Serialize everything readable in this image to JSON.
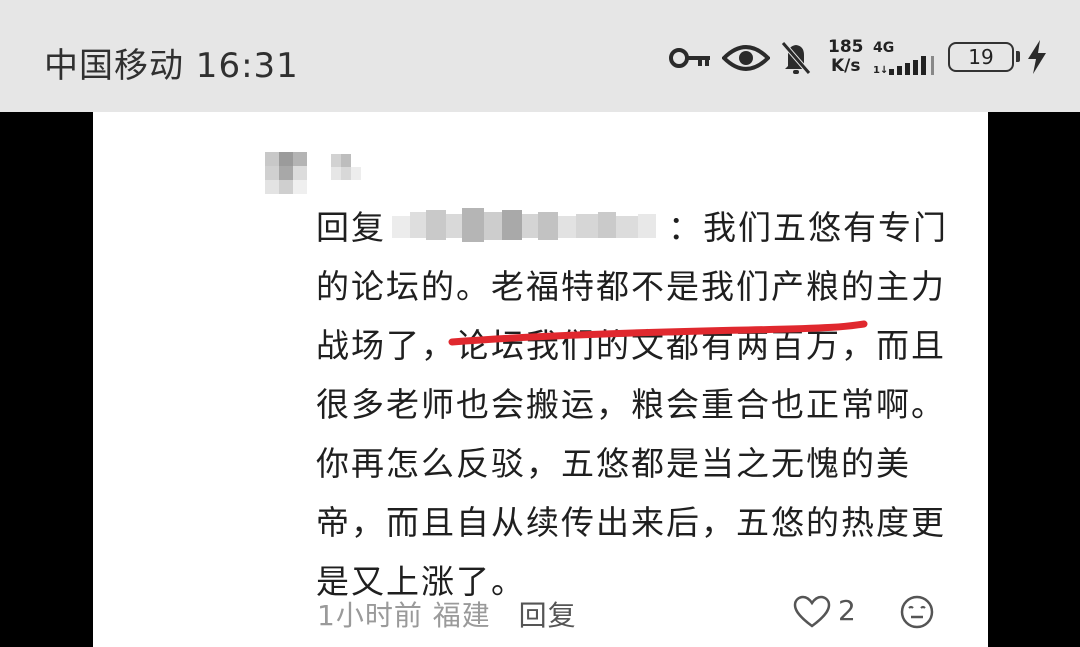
{
  "status_bar": {
    "carrier_time": "中国移动 16:31",
    "net_speed_value": "185",
    "net_speed_unit": "K/s",
    "network_type": "4G",
    "battery_level": "19",
    "icons": [
      "key-icon",
      "eye-icon",
      "bell-off-icon",
      "signal-icon",
      "battery-icon",
      "charging-icon"
    ]
  },
  "comment": {
    "reply_prefix": "回复",
    "colon_text": "：我们五悠有专门",
    "lines": [
      "的论坛的。老福特都不是我们产粮的主力",
      "战场了，论坛我们的文都有两百万，而且",
      "很多老师也会搬运，粮会重合也正常啊。",
      "你再怎么反驳，五悠都是当之无愧的美",
      "帝，而且自从续传出来后，五悠的热度更",
      "是又上涨了。"
    ],
    "highlight_color": "#e0282e"
  },
  "meta": {
    "time_ago": "1小时前",
    "location": "福建",
    "reply_label": "回复",
    "like_count": "2"
  }
}
